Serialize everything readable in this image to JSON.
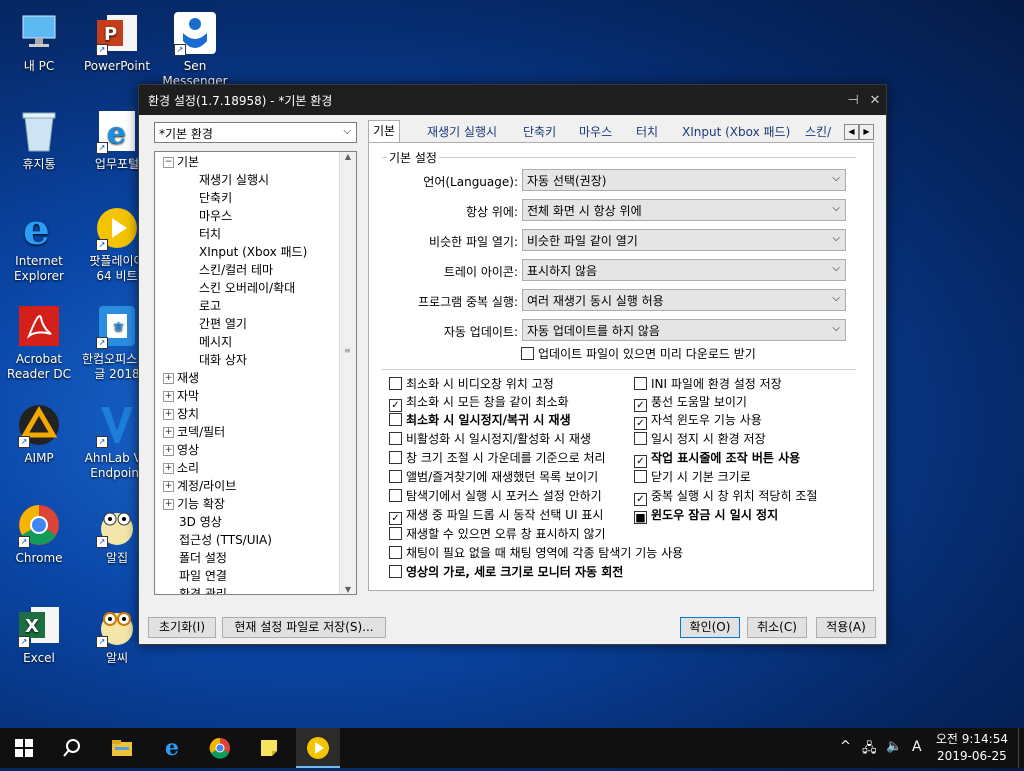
{
  "desktop": {
    "icons": [
      {
        "label": "내 PC"
      },
      {
        "label": "PowerPoint"
      },
      {
        "label": "Sen Messenger"
      },
      {
        "label": "휴지통"
      },
      {
        "label": "업무포털"
      },
      {
        "label": "Internet Explorer"
      },
      {
        "label": "팟플레이어 64 비트"
      },
      {
        "label": "Acrobat Reader DC"
      },
      {
        "label": "한컴오피스 한글 2018"
      },
      {
        "label": "AIMP"
      },
      {
        "label": "AhnLab V3 Endpoint"
      },
      {
        "label": "Chrome"
      },
      {
        "label": "알집"
      },
      {
        "label": "Excel"
      },
      {
        "label": "알씨"
      }
    ]
  },
  "dialog": {
    "title": "환경 설정(1.7.18958) - *기본 환경",
    "preset_value": "*기본 환경",
    "tree": {
      "items": [
        {
          "label": "기본"
        },
        {
          "label": "재생기 실행시"
        },
        {
          "label": "단축키"
        },
        {
          "label": "마우스"
        },
        {
          "label": "터치"
        },
        {
          "label": "XInput (Xbox 패드)"
        },
        {
          "label": "스킨/컬러 테마"
        },
        {
          "label": "스킨 오버레이/확대"
        },
        {
          "label": "로고"
        },
        {
          "label": "간편 열기"
        },
        {
          "label": "메시지"
        },
        {
          "label": "대화 상자"
        },
        {
          "label": "재생"
        },
        {
          "label": "자막"
        },
        {
          "label": "장치"
        },
        {
          "label": "코덱/필터"
        },
        {
          "label": "영상"
        },
        {
          "label": "소리"
        },
        {
          "label": "계정/라이브"
        },
        {
          "label": "기능 확장"
        },
        {
          "label": "3D 영상"
        },
        {
          "label": "접근성 (TTS/UIA)"
        },
        {
          "label": "폴더 설정"
        },
        {
          "label": "파일 연결"
        },
        {
          "label": "환경 관리"
        }
      ]
    },
    "tabs": [
      {
        "label": "기본"
      },
      {
        "label": "재생기 실행시"
      },
      {
        "label": "단축키"
      },
      {
        "label": "마우스"
      },
      {
        "label": "터치"
      },
      {
        "label": "XInput (Xbox 패드)"
      },
      {
        "label": "스킨/"
      }
    ],
    "group_title": "기본 설정",
    "settings": [
      {
        "label": "언어(Language):",
        "value": "자동 선택(권장)"
      },
      {
        "label": "항상 위에:",
        "value": "전체 화면 시 항상 위에"
      },
      {
        "label": "비슷한 파일 열기:",
        "value": "비슷한 파일 같이 열기"
      },
      {
        "label": "트레이 아이콘:",
        "value": "표시하지 않음"
      },
      {
        "label": "프로그램 중복 실행:",
        "value": "여러 재생기 동시 실행 허용"
      },
      {
        "label": "자동 업데이트:",
        "value": "자동 업데이트를 하지 않음"
      }
    ],
    "update_checkbox": {
      "label": "업데이트 파일이 있으면 미리 다운로드 받기",
      "checked": false
    },
    "checkboxes_left": [
      {
        "label": "최소화 시 비디오창 위치 고정",
        "checked": false
      },
      {
        "label": "최소화 시 모든 창을 같이 최소화",
        "checked": true
      },
      {
        "label": "최소화 시 일시정지/복귀 시 재생",
        "checked": false
      },
      {
        "label": "비활성화 시 일시정지/활성화 시 재생",
        "checked": false
      },
      {
        "label": "창 크기 조절 시 가운데를 기준으로 처리",
        "checked": false
      },
      {
        "label": "앨범/즐겨찾기에 재생했던 목록 보이기",
        "checked": false
      },
      {
        "label": "탐색기에서 실행 시 포커스 설정 안하기",
        "checked": false
      },
      {
        "label": "재생 중 파일 드롭 시 동작 선택 UI 표시",
        "checked": true
      },
      {
        "label": "재생할 수 있으면 오류 창 표시하지 않기",
        "checked": false
      },
      {
        "label": "채팅이 필요 없을 때 채팅 영역에 각종 탐색기 기능 사용",
        "checked": false
      },
      {
        "label": "영상의 가로, 세로 크기로 모니터 자동 회전",
        "checked": false
      }
    ],
    "checkboxes_right": [
      {
        "label": "INI 파일에 환경 설정 저장",
        "checked": false
      },
      {
        "label": "풍선 도움말 보이기",
        "checked": true
      },
      {
        "label": "자석 윈도우 기능 사용",
        "checked": true
      },
      {
        "label": "일시 정지 시 환경 저장",
        "checked": false
      },
      {
        "label": "작업 표시줄에 조작 버튼 사용",
        "checked": true
      },
      {
        "label": "닫기 시 기본 크기로",
        "checked": false
      },
      {
        "label": "중복 실행 시 창 위치 적당히 조절",
        "checked": true
      },
      {
        "label": "윈도우 잠금 시 일시 정지",
        "checked": true
      }
    ],
    "buttons": {
      "reset": "초기화(I)",
      "save_as": "현재 설정 파일로 저장(S)...",
      "ok": "확인(O)",
      "cancel": "취소(C)",
      "apply": "적용(A)"
    }
  },
  "taskbar": {
    "clock_time": "오전 9:14:54",
    "clock_date": "2019-06-25",
    "ime": "A"
  }
}
